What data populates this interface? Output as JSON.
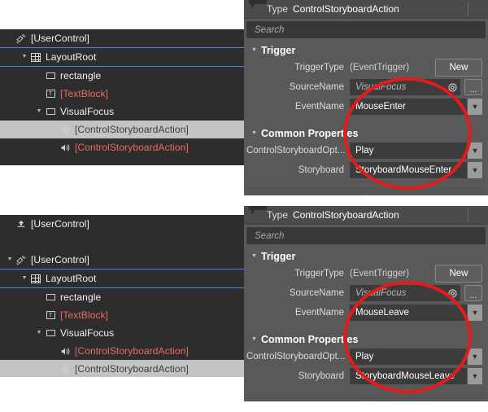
{
  "top": {
    "tree": {
      "name": "objects-and-timeline-tree",
      "rows": [
        {
          "label": "[UserControl]",
          "icon": "usercontrol-icon",
          "indent": 0,
          "twisty": "",
          "color": "white",
          "state": "normal"
        },
        {
          "label": "LayoutRoot",
          "icon": "grid-icon",
          "indent": 1,
          "twisty": "▼",
          "color": "white",
          "state": "focus"
        },
        {
          "label": "rectangle",
          "icon": "rectangle-icon",
          "indent": 2,
          "twisty": "",
          "color": "white",
          "state": "normal"
        },
        {
          "label": "[TextBlock]",
          "icon": "textblock-icon",
          "indent": 2,
          "twisty": "",
          "color": "red",
          "state": "normal"
        },
        {
          "label": "VisualFocus",
          "icon": "rectangle-icon",
          "indent": 2,
          "twisty": "▼",
          "color": "white",
          "state": "normal"
        },
        {
          "label": "[ControlStoryboardAction]",
          "icon": "gear-behavior-icon",
          "indent": 3,
          "twisty": "",
          "color": "dark",
          "state": "selected"
        },
        {
          "label": "[ControlStoryboardAction]",
          "icon": "behavior-icon",
          "indent": 3,
          "twisty": "",
          "color": "red",
          "state": "normal"
        }
      ]
    },
    "props": {
      "type_label": "Type",
      "type_value": "ControlStoryboardAction",
      "search_placeholder": "Search",
      "sections": [
        {
          "title": "Trigger",
          "twisty": "▼",
          "rows": [
            {
              "kind": "static",
              "label": "TriggerType",
              "value": "(EventTrigger)",
              "button": "New"
            },
            {
              "kind": "text",
              "label": "SourceName",
              "value": "VisualFocus",
              "placeholder": true,
              "target": true,
              "dots": "..."
            },
            {
              "kind": "combo",
              "label": "EventName",
              "value": "MouseEnter"
            }
          ]
        },
        {
          "title": "Common Properties",
          "twisty": "▼",
          "rows": [
            {
              "kind": "combo",
              "label": "ControlStoryboardOpt...",
              "value": "Play"
            },
            {
              "kind": "combo",
              "label": "Storyboard",
              "value": "StoryboardMouseEnter"
            }
          ]
        }
      ],
      "more_glyph": "⌄"
    }
  },
  "bottom": {
    "tree": {
      "name": "objects-and-timeline-tree",
      "rows": [
        {
          "label": "[UserControl]",
          "icon": "go-up-icon",
          "indent": 0,
          "twisty": "",
          "color": "white",
          "state": "normal"
        },
        {
          "label": "",
          "icon": "",
          "indent": 0,
          "twisty": "",
          "color": "white",
          "state": "blank"
        },
        {
          "label": "[UserControl]",
          "icon": "usercontrol-icon",
          "indent": 0,
          "twisty": "▼",
          "color": "white",
          "state": "normal"
        },
        {
          "label": "LayoutRoot",
          "icon": "grid-icon",
          "indent": 1,
          "twisty": "▼",
          "color": "white",
          "state": "focus"
        },
        {
          "label": "rectangle",
          "icon": "rectangle-icon",
          "indent": 2,
          "twisty": "",
          "color": "white",
          "state": "normal"
        },
        {
          "label": "[TextBlock]",
          "icon": "textblock-icon",
          "indent": 2,
          "twisty": "",
          "color": "red",
          "state": "normal"
        },
        {
          "label": "VisualFocus",
          "icon": "rectangle-icon",
          "indent": 2,
          "twisty": "▼",
          "color": "white",
          "state": "normal"
        },
        {
          "label": "[ControlStoryboardAction]",
          "icon": "behavior-icon",
          "indent": 3,
          "twisty": "",
          "color": "red",
          "state": "normal"
        },
        {
          "label": "[ControlStoryboardAction]",
          "icon": "gear-behavior-icon",
          "indent": 3,
          "twisty": "",
          "color": "dark",
          "state": "selected"
        }
      ]
    },
    "props": {
      "type_label": "Type",
      "type_value": "ControlStoryboardAction",
      "search_placeholder": "Search",
      "sections": [
        {
          "title": "Trigger",
          "twisty": "▼",
          "rows": [
            {
              "kind": "static",
              "label": "TriggerType",
              "value": "(EventTrigger)",
              "button": "New"
            },
            {
              "kind": "text",
              "label": "SourceName",
              "value": "VisualFocus",
              "placeholder": true,
              "target": true,
              "dots": "..."
            },
            {
              "kind": "combo",
              "label": "EventName",
              "value": "MouseLeave"
            }
          ]
        },
        {
          "title": "Common Properties",
          "twisty": "▼",
          "rows": [
            {
              "kind": "combo",
              "label": "ControlStoryboardOpt...",
              "value": "Play"
            },
            {
              "kind": "combo",
              "label": "Storyboard",
              "value": "StoryboardMouseLeave"
            }
          ]
        }
      ],
      "more_glyph": "⌄"
    }
  },
  "annotations": {
    "circle_color": "#e51b1b",
    "circles": [
      {
        "name": "top-highlight-circle"
      },
      {
        "name": "bottom-highlight-circle"
      }
    ]
  },
  "colors": {
    "tree_bg": "#2d2d2d",
    "props_bg": "#5a5a5a",
    "field_bg": "#3c3c3c",
    "selection_bg": "#c3c3c3",
    "focus_border": "#3c8ce0",
    "red_text": "#ef6a63"
  }
}
